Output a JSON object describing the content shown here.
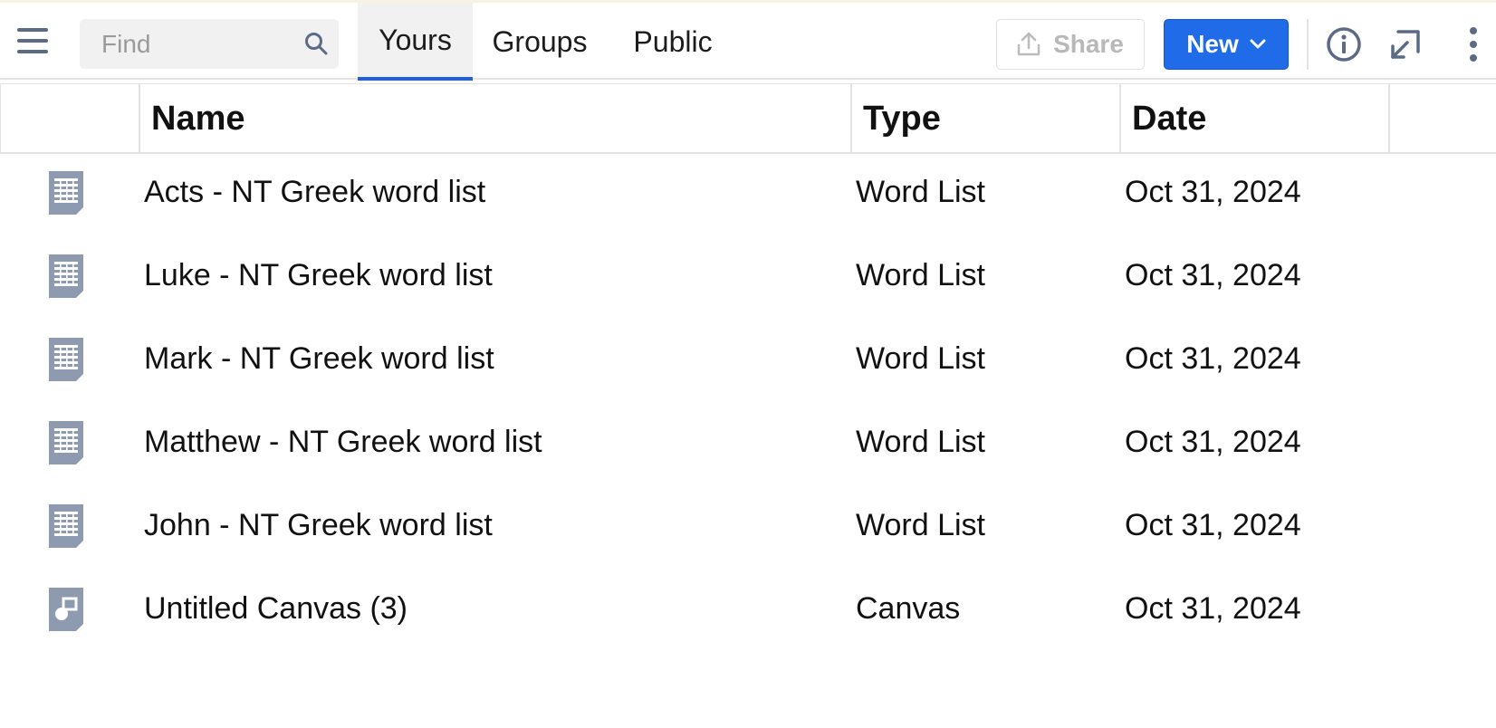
{
  "toolbar": {
    "find_placeholder": "Find",
    "tabs": [
      {
        "label": "Yours",
        "active": true
      },
      {
        "label": "Groups",
        "active": false
      },
      {
        "label": "Public",
        "active": false
      }
    ],
    "share_label": "Share",
    "new_label": "New"
  },
  "table": {
    "columns": [
      "Name",
      "Type",
      "Date"
    ],
    "rows": [
      {
        "icon": "word-list-icon",
        "name": "Acts - NT Greek word list",
        "type": "Word List",
        "date": "Oct 31, 2024"
      },
      {
        "icon": "word-list-icon",
        "name": "Luke - NT Greek word list",
        "type": "Word List",
        "date": "Oct 31, 2024"
      },
      {
        "icon": "word-list-icon",
        "name": "Mark - NT Greek word list",
        "type": "Word List",
        "date": "Oct 31, 2024"
      },
      {
        "icon": "word-list-icon",
        "name": "Matthew - NT Greek word list",
        "type": "Word List",
        "date": "Oct 31, 2024"
      },
      {
        "icon": "word-list-icon",
        "name": "John - NT Greek word list",
        "type": "Word List",
        "date": "Oct 31, 2024"
      },
      {
        "icon": "canvas-icon",
        "name": "Untitled Canvas (3)",
        "type": "Canvas",
        "date": "Oct 31, 2024"
      }
    ]
  },
  "colors": {
    "accent": "#1f6be8",
    "icon_gray": "#8e9ab0",
    "nav_icon": "#5b6b85"
  }
}
